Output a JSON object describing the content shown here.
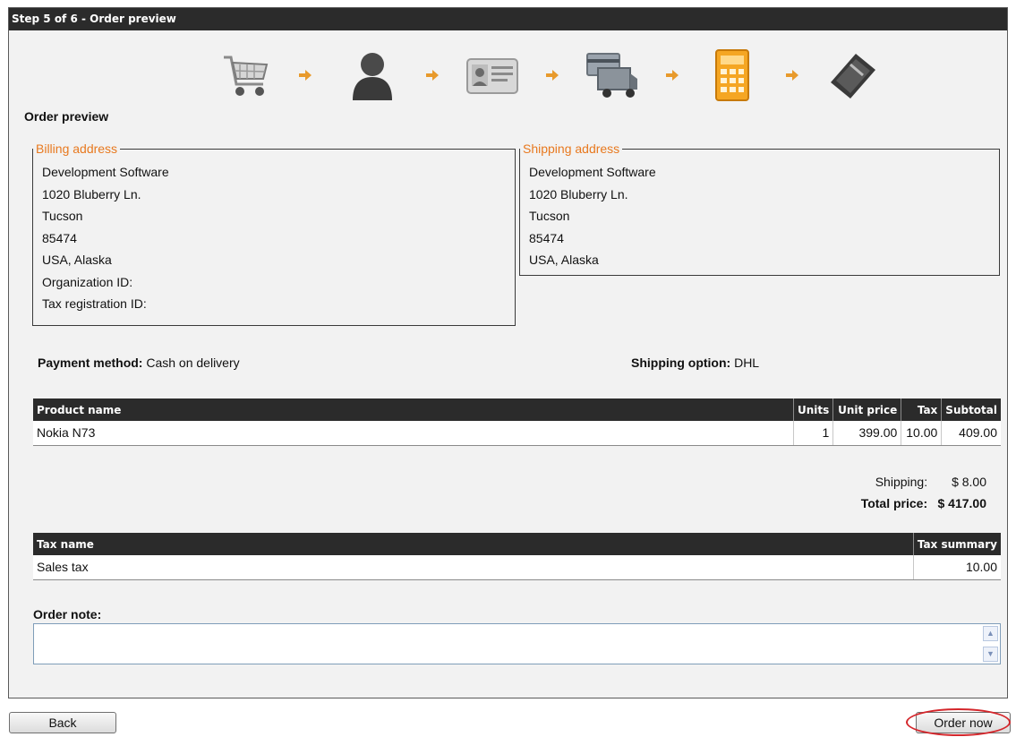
{
  "window": {
    "title": "Step 5 of 6 - Order preview"
  },
  "steps": [
    "cart-icon",
    "customer-icon",
    "id-card-icon",
    "shipping-truck-icon",
    "calculator-icon",
    "payment-wallet-icon"
  ],
  "section_title": "Order preview",
  "billing": {
    "legend": "Billing address",
    "lines": [
      "Development Software",
      "1020 Bluberry Ln.",
      "Tucson",
      "85474",
      "USA, Alaska",
      "Organization ID:",
      "Tax registration ID:"
    ]
  },
  "shipping": {
    "legend": "Shipping address",
    "lines": [
      "Development Software",
      "1020 Bluberry Ln.",
      "Tucson",
      "85474",
      "USA, Alaska"
    ]
  },
  "payment": {
    "label": "Payment method:",
    "value": "Cash on delivery"
  },
  "shipping_option": {
    "label": "Shipping option:",
    "value": "DHL"
  },
  "products": {
    "headers": [
      "Product name",
      "Units",
      "Unit price",
      "Tax",
      "Subtotal"
    ],
    "rows": [
      [
        "Nokia N73",
        "1",
        "399.00",
        "10.00",
        "409.00"
      ]
    ]
  },
  "totals": {
    "shipping_label": "Shipping:",
    "shipping_value": "$ 8.00",
    "total_label": "Total price:",
    "total_value": "$ 417.00"
  },
  "taxes": {
    "headers": [
      "Tax name",
      "Tax summary"
    ],
    "rows": [
      [
        "Sales tax",
        "10.00"
      ]
    ]
  },
  "note": {
    "label": "Order note:",
    "value": ""
  },
  "buttons": {
    "back": "Back",
    "order": "Order now"
  },
  "colors": {
    "legend": "#e8791f",
    "header_bg": "#2b2b2b",
    "highlight": "#d4262b"
  }
}
